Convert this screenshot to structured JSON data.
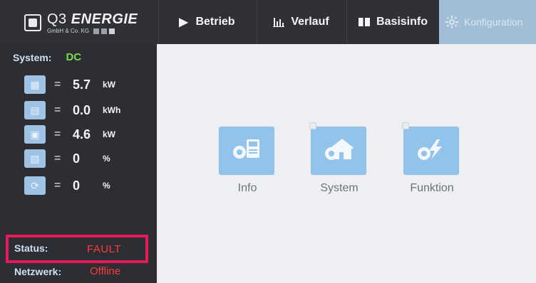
{
  "header": {
    "brand": "ENERGIE",
    "brand_prefix": "Q3",
    "brand_sub": "GmbH & Co. KG",
    "tabs": [
      {
        "label": "Betrieb",
        "icon": "play-icon"
      },
      {
        "label": "Verlauf",
        "icon": "bar-chart-icon"
      },
      {
        "label": "Basisinfo",
        "icon": "book-icon"
      },
      {
        "label": "Konfiguration",
        "icon": "gear-icon"
      }
    ]
  },
  "sidebar": {
    "system_label": "System:",
    "system_value": "DC",
    "metrics": [
      {
        "icon": "solar-panel-icon",
        "eq": "=",
        "value": "5.7",
        "unit": "kW"
      },
      {
        "icon": "battery-icon",
        "eq": "=",
        "value": "0.0",
        "unit": "kWh"
      },
      {
        "icon": "inverter-icon",
        "eq": "=",
        "value": "4.6",
        "unit": "kW"
      },
      {
        "icon": "panel-percent-icon",
        "eq": "=",
        "value": "0",
        "unit": "%"
      },
      {
        "icon": "cycle-icon",
        "eq": "=",
        "value": "0",
        "unit": "%"
      }
    ],
    "status_label": "Status:",
    "status_value": "FAULT",
    "network_label": "Netzwerk:",
    "network_value": "Offline"
  },
  "main": {
    "apps": [
      {
        "label": "Info",
        "icon": "info-gear-save-icon"
      },
      {
        "label": "System",
        "icon": "house-gear-icon"
      },
      {
        "label": "Funktion",
        "icon": "bolt-gear-icon"
      }
    ]
  },
  "colors": {
    "topbar": "#2f3136",
    "sidebar": "#2c2e34",
    "accent_blue": "#92c3ea",
    "active_tab": "#a7c6df",
    "status_border": "#e71b5a",
    "status_text": "#ff3b3b",
    "system_value": "#7fdb4a"
  }
}
